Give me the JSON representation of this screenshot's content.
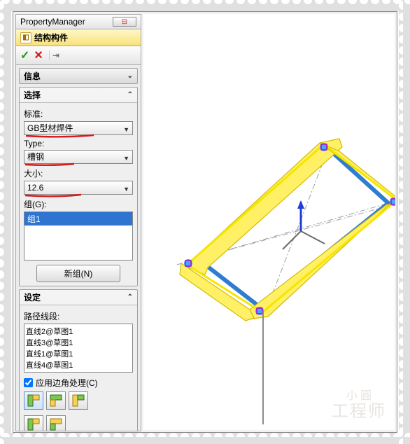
{
  "window": {
    "title": "PropertyManager"
  },
  "feature": {
    "title": "结构构件"
  },
  "sections": {
    "info": {
      "title": "信息"
    },
    "select": {
      "title": "选择",
      "standard_label": "标准:",
      "standard_value": "GB型材焊件",
      "type_label": "Type:",
      "type_value": "槽钢",
      "size_label": "大小:",
      "size_value": "12.6",
      "group_label": "组(G):",
      "groups": [
        "组1"
      ],
      "new_group_btn": "新组(N)"
    },
    "settings": {
      "title": "设定",
      "path_label": "路径线段:",
      "paths": [
        "直线2@草图1",
        "直线3@草图1",
        "直线1@草图1",
        "直线4@草图1"
      ],
      "apply_corner_label": "应用边角处理(C)",
      "apply_corner_checked": true
    }
  },
  "icons": {
    "ok": "✓",
    "cancel": "✕",
    "pin": "⇥",
    "pushpin": "◧"
  },
  "watermark": {
    "line1": "小 圓",
    "line2": "工程师"
  },
  "chart_data": null
}
